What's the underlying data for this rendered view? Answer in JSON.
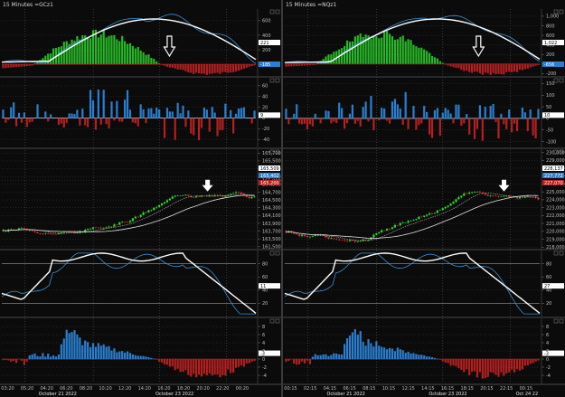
{
  "colors": {
    "background": "#0b0b0b",
    "grid": "#3a3a3a",
    "sep": "#4a4a4a",
    "pos_hist": "#27b827",
    "neg_hist": "#b52020",
    "blue_hist": "#2a7fd0",
    "candle_up": "#2ee02e",
    "candle_down": "#e03030",
    "white_line": "#ffffff",
    "blue_line": "#3a8fd8",
    "h_level": "#3f8fd0"
  },
  "left": {
    "title": "15 Minutes  =GCz1",
    "macd": {
      "ticks": [
        "600",
        "400",
        "200",
        "0"
      ],
      "tick_levels": [
        600,
        400,
        200,
        0
      ],
      "range": [
        -160,
        760
      ],
      "value_box_1": "221",
      "value_box_2": "-185"
    },
    "p2": {
      "ticks": [
        "60",
        "40",
        "20",
        "0",
        "-20",
        "-40"
      ],
      "tick_levels": [
        60,
        40,
        20,
        0,
        -20,
        -40
      ],
      "range": [
        -55,
        75
      ],
      "value_box_1": "9",
      "value_box_2": ""
    },
    "price": {
      "ticks": [
        "165,700",
        "165,500",
        "165,300",
        "165,100",
        "165,000",
        "164,900",
        "164,700",
        "164,500",
        "164,300",
        "164,100",
        "163,900",
        "163,700",
        "163,500",
        "161,500"
      ],
      "tick_levels": [
        165700,
        165500,
        165300,
        165100,
        165000,
        164900,
        164700,
        164500,
        164300,
        164100,
        163900,
        163700,
        163500,
        163300
      ],
      "range": [
        163250,
        165800
      ],
      "value_box_1": "165,509",
      "value_box_2": "165,402",
      "value_box_3": "165,200"
    },
    "stoch": {
      "ticks": [
        "80",
        "60",
        "40",
        "20"
      ],
      "tick_levels": [
        80,
        60,
        40,
        20
      ],
      "range": [
        0,
        100
      ],
      "value_box_1": "11",
      "value_box_2": ""
    },
    "osc": {
      "ticks": [
        "8",
        "6",
        "4",
        "2",
        "0",
        "-2",
        "-4"
      ],
      "tick_levels": [
        8,
        6,
        4,
        2,
        0,
        -2,
        -4
      ],
      "range": [
        -6,
        10
      ],
      "value_box_1": "-3",
      "value_box_2": ""
    },
    "xaxis": {
      "ticks": [
        "03:20",
        "05:20",
        "04:20",
        "06:20",
        "08:20",
        "10:20",
        "12:20",
        "14:20",
        "16:20",
        "18:20",
        "20:20",
        "22:20",
        "00:20"
      ],
      "dates": [
        "October 21 2022",
        "October 23 2022"
      ]
    }
  },
  "right": {
    "title": "15 Minutes  =NQz1",
    "macd": {
      "ticks": [
        "1,000",
        "800",
        "600",
        "400",
        "200",
        "0",
        "-200"
      ],
      "tick_levels": [
        1000,
        800,
        600,
        400,
        200,
        0,
        -200
      ],
      "range": [
        -250,
        1150
      ],
      "value_box_1": "1,022",
      "value_box_2": "-656"
    },
    "p2": {
      "ticks": [
        "150",
        "100",
        "50",
        "0",
        "-50",
        "-100"
      ],
      "tick_levels": [
        150,
        100,
        50,
        0,
        -50,
        -100
      ],
      "range": [
        -125,
        175
      ],
      "value_box_1": "10",
      "value_box_2": ""
    },
    "price": {
      "ticks": [
        "230,000",
        "229,000",
        "228,000",
        "227,000",
        "226,000",
        "225,000",
        "224,000",
        "223,000",
        "222,000",
        "221,000",
        "220,000",
        "219,000",
        "218,000"
      ],
      "tick_levels": [
        230000,
        229000,
        228000,
        227000,
        226000,
        225000,
        224000,
        223000,
        222000,
        221000,
        220000,
        219000,
        218000
      ],
      "range": [
        217800,
        230400
      ],
      "value_box_1": "228,137",
      "value_box_2": "227,772",
      "value_box_3": "227,070"
    },
    "stoch": {
      "ticks": [
        "80",
        "60",
        "40",
        "20"
      ],
      "tick_levels": [
        80,
        60,
        40,
        20
      ],
      "range": [
        0,
        100
      ],
      "value_box_1": "27",
      "value_box_2": ""
    },
    "osc": {
      "ticks": [
        "8",
        "6",
        "4",
        "2",
        "0",
        "-2",
        "-4"
      ],
      "tick_levels": [
        8,
        6,
        4,
        2,
        0,
        -2,
        -4
      ],
      "range": [
        -6,
        10
      ],
      "value_box_1": "-3",
      "value_box_2": ""
    },
    "xaxis": {
      "ticks": [
        "00:15",
        "02:15",
        "04:15",
        "06:15",
        "08:15",
        "10:15",
        "12:15",
        "14:15",
        "16:15",
        "18:15",
        "20:15",
        "22:15",
        "00:15"
      ],
      "dates": [
        "October 21 2022",
        "October 23 2022",
        "Oct 24 22"
      ]
    }
  }
}
